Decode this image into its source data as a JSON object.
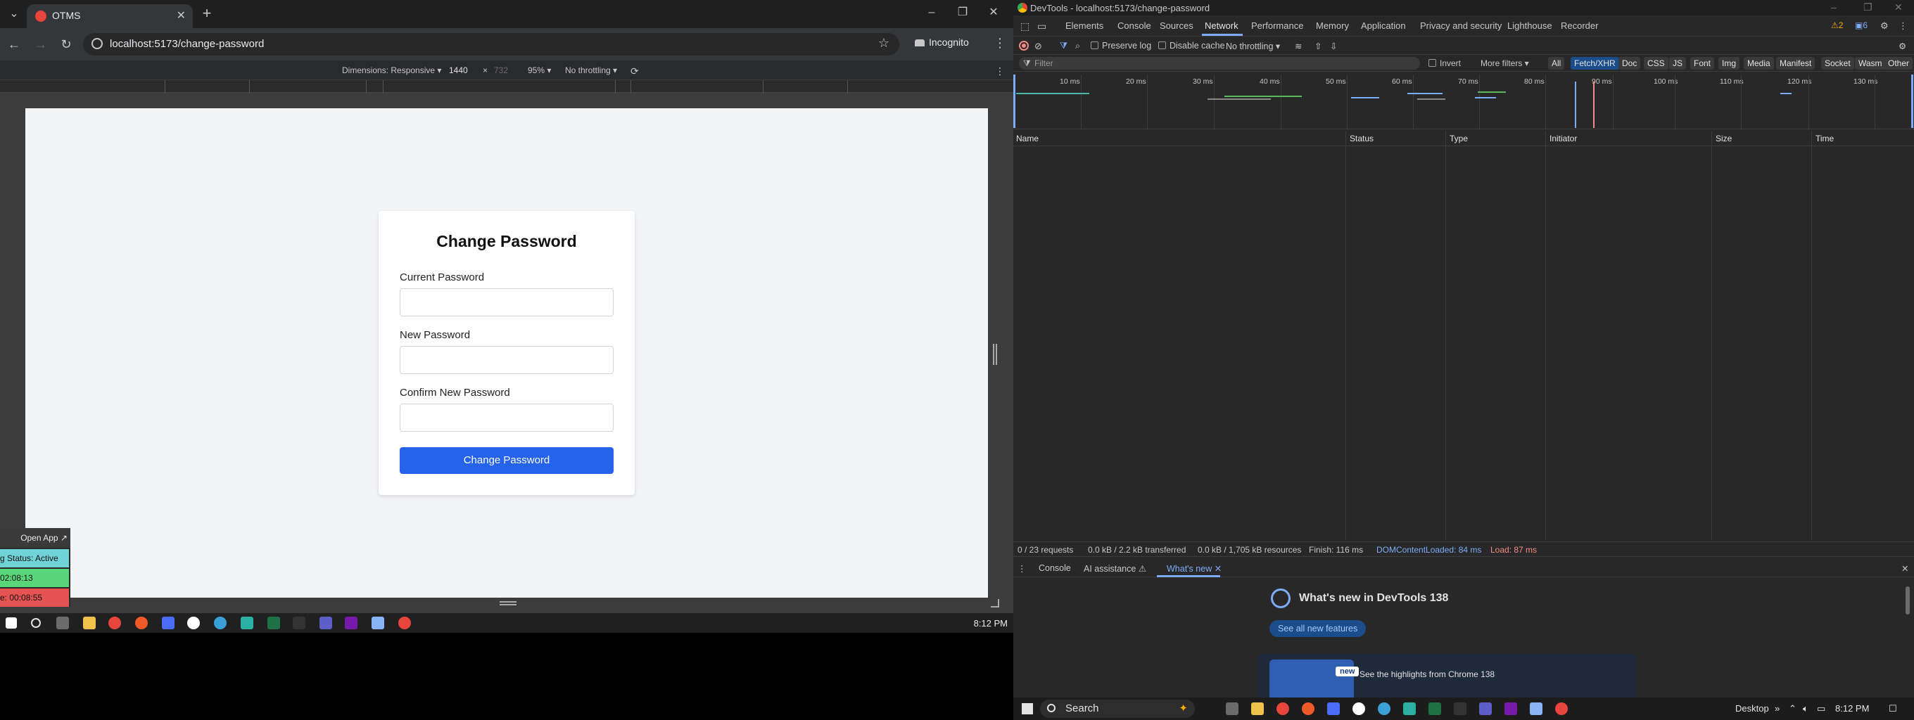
{
  "browser": {
    "tab_title": "OTMS",
    "url": "localhost:5173/change-password",
    "incognito_label": "Incognito"
  },
  "device_toolbar": {
    "dimensions_label": "Dimensions: Responsive ▾",
    "width": "1440",
    "times": "×",
    "height": "732",
    "zoom": "95% ▾",
    "throttling": "No throttling ▾"
  },
  "page": {
    "title": "Change Password",
    "fields": [
      {
        "label": "Current Password",
        "value": ""
      },
      {
        "label": "New Password",
        "value": ""
      },
      {
        "label": "Confirm New Password",
        "value": ""
      }
    ],
    "submit_label": "Change Password"
  },
  "widget": {
    "open_app": "Open App ↗",
    "status": "g Status: Active",
    "timer1": "02:08:13",
    "timer2": "e: 00:08:55",
    "colors": {
      "status": "#6fd3d8",
      "timer1": "#5ad67a",
      "timer2": "#e55353"
    }
  },
  "taskbar_left": {
    "clock": "8:12 PM"
  },
  "devtools": {
    "window_title": "DevTools - localhost:5173/change-password",
    "tabs": [
      "Elements",
      "Console",
      "Sources",
      "Network",
      "Performance",
      "Memory",
      "Application",
      "Privacy and security",
      "Lighthouse",
      "Recorder"
    ],
    "active_tab": "Network",
    "badges": {
      "warnings": "2",
      "issues": "6"
    },
    "network_toolbar": {
      "preserve_log": "Preserve log",
      "disable_cache": "Disable cache",
      "throttling": "No throttling"
    },
    "filter": {
      "placeholder": "Filter",
      "invert": "Invert",
      "more_filters": "More filters ▾",
      "chips": [
        "All",
        "Fetch/XHR",
        "Doc",
        "CSS",
        "JS",
        "Font",
        "Img",
        "Media",
        "Manifest",
        "Socket",
        "Wasm",
        "Other"
      ],
      "active_chip": "Fetch/XHR"
    },
    "overview_ticks": [
      "10 ms",
      "20 ms",
      "30 ms",
      "40 ms",
      "50 ms",
      "60 ms",
      "70 ms",
      "80 ms",
      "90 ms",
      "100 ms",
      "110 ms",
      "120 ms",
      "130 ms"
    ],
    "columns": [
      "Name",
      "Status",
      "Type",
      "Initiator",
      "Size",
      "Time"
    ],
    "status_bar": {
      "requests": "0 / 23 requests",
      "transferred": "0.0 kB / 2.2 kB transferred",
      "resources": "0.0 kB / 1,705 kB resources",
      "finish": "Finish: 116 ms",
      "dom_loaded": "DOMContentLoaded: 84 ms",
      "load": "Load: 87 ms"
    },
    "drawer": {
      "tabs": [
        "Console",
        "AI assistance ⚠",
        "What's new ✕"
      ],
      "active": "What's new ✕",
      "whats_new_title": "What's new in DevTools 138",
      "see_all": "See all new features",
      "new_badge": "new",
      "highlights": "See the highlights from Chrome 138"
    }
  },
  "taskbar_right": {
    "search": "Search",
    "desktop": "Desktop",
    "clock": "8:12 PM"
  }
}
